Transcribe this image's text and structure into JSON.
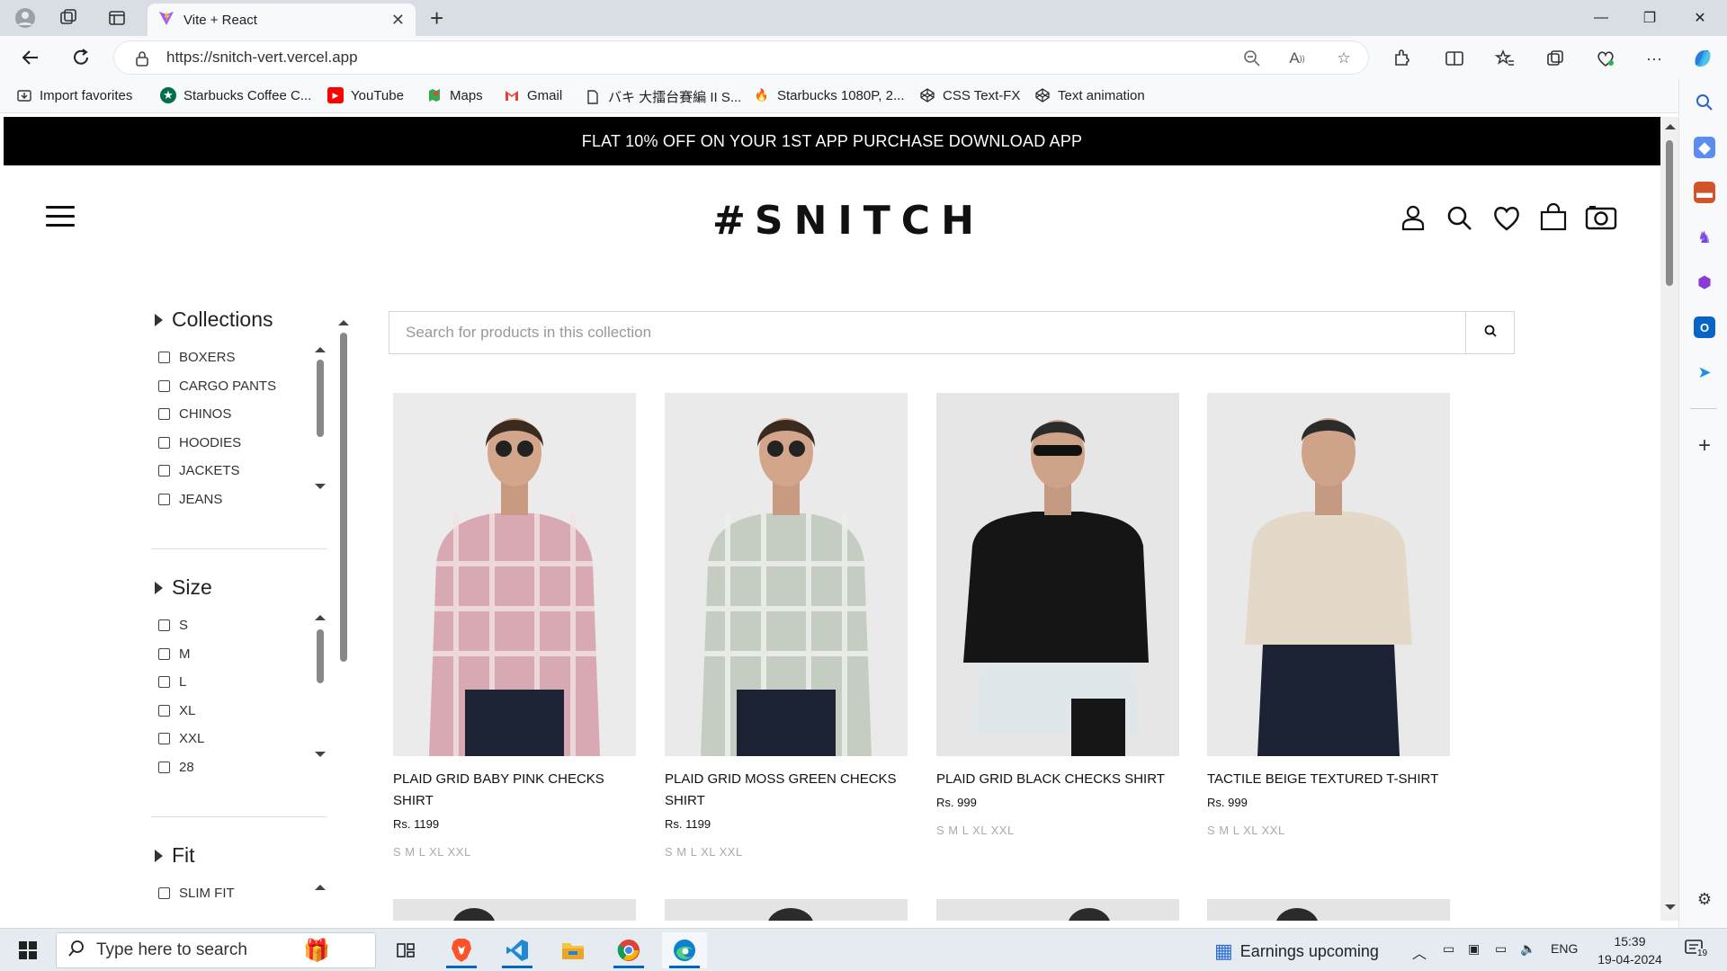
{
  "browser": {
    "tab_title": "Vite + React",
    "url": "https://snitch-vert.vercel.app",
    "bookmarks": [
      {
        "label": "Import favorites",
        "icon": "import-icon"
      },
      {
        "label": "Starbucks Coffee C...",
        "icon": "starbucks-icon"
      },
      {
        "label": "YouTube",
        "icon": "youtube-icon"
      },
      {
        "label": "Maps",
        "icon": "maps-icon"
      },
      {
        "label": "Gmail",
        "icon": "gmail-icon"
      },
      {
        "label": "バキ 大擂台賽編 II S...",
        "icon": "page-icon"
      },
      {
        "label": "Starbucks 1080P, 2...",
        "icon": "fire-icon"
      },
      {
        "label": "CSS Text-FX",
        "icon": "codepen-icon"
      },
      {
        "label": "Text animation",
        "icon": "codepen-icon"
      }
    ]
  },
  "site": {
    "promo": "FLAT 10% OFF ON YOUR 1ST APP PURCHASE DOWNLOAD APP",
    "logo_text": "SNITCH",
    "logo_mark": "#"
  },
  "filters": {
    "collections": {
      "title": "Collections",
      "items": [
        "BOXERS",
        "CARGO PANTS",
        "CHINOS",
        "HOODIES",
        "JACKETS",
        "JEANS"
      ]
    },
    "size": {
      "title": "Size",
      "items": [
        "S",
        "M",
        "L",
        "XL",
        "XXL",
        "28"
      ]
    },
    "fit": {
      "title": "Fit",
      "items": [
        "SLIM FIT"
      ]
    }
  },
  "search": {
    "placeholder": "Search for products in this collection"
  },
  "products": [
    {
      "name": "PLAID GRID BABY PINK CHECKS SHIRT",
      "price": "Rs. 1199",
      "sizes": "S M L XL XXL"
    },
    {
      "name": "PLAID GRID MOSS GREEN CHECKS SHIRT",
      "price": "Rs. 1199",
      "sizes": "S M L XL XXL"
    },
    {
      "name": "PLAID GRID BLACK CHECKS SHIRT",
      "price": "Rs. 999",
      "sizes": "S M L XL XXL"
    },
    {
      "name": "TACTILE BEIGE TEXTURED T-SHIRT",
      "price": "Rs. 999",
      "sizes": "S M L XL XXL"
    }
  ],
  "taskbar": {
    "search_placeholder": "Type here to search",
    "weather": "Earnings upcoming",
    "lang": "ENG",
    "time": "15:39",
    "date": "19-04-2024",
    "notifications": "19"
  },
  "colors": {
    "promo_bg": "#000000",
    "accent": "#0067c0",
    "shirt_pink": "#d9a9b3",
    "shirt_green": "#c5cdc2",
    "shirt_black": "#151515",
    "shirt_beige": "#e4d9c8"
  }
}
